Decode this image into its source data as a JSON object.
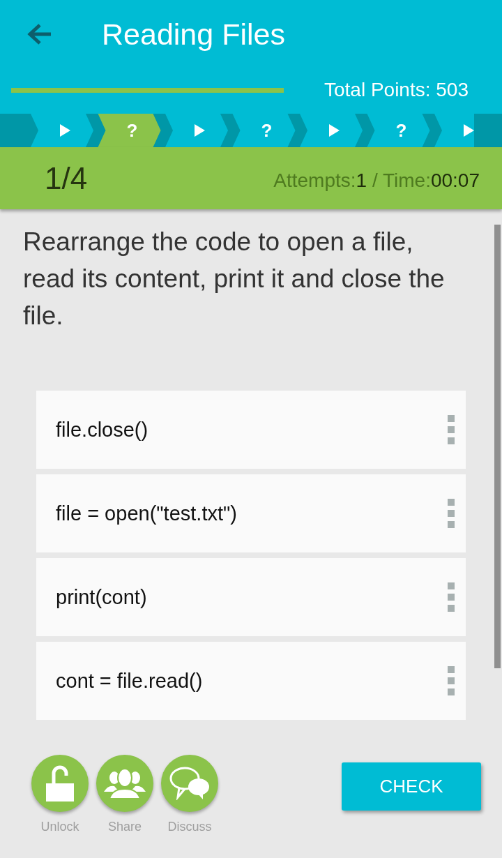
{
  "header": {
    "title": "Reading Files",
    "total_points": "Total Points: 503"
  },
  "steps": [
    {
      "kind": "lesson",
      "selected": false
    },
    {
      "kind": "quiz",
      "label": "?",
      "selected": true
    },
    {
      "kind": "lesson",
      "selected": false
    },
    {
      "kind": "quiz",
      "label": "?",
      "selected": false
    },
    {
      "kind": "lesson",
      "selected": false
    },
    {
      "kind": "quiz",
      "label": "?",
      "selected": false
    },
    {
      "kind": "lesson",
      "selected": false
    }
  ],
  "status": {
    "counter": "1/4",
    "attempts_label": "Attempts:",
    "attempts": "1",
    "time_label": " / Time:",
    "time": "00:07"
  },
  "question": "Rearrange the code to open a file, read its content, print it and close the file.",
  "code_lines": [
    {
      "text": "file.close()"
    },
    {
      "text": "file = open(\"test.txt\")"
    },
    {
      "text": "print(cont)"
    },
    {
      "text": "cont = file.read()"
    }
  ],
  "actions": [
    {
      "kind": "unlock",
      "label": "Unlock"
    },
    {
      "kind": "share",
      "label": "Share"
    },
    {
      "kind": "discuss",
      "label": "Discuss"
    }
  ],
  "check_button": "CHECK"
}
